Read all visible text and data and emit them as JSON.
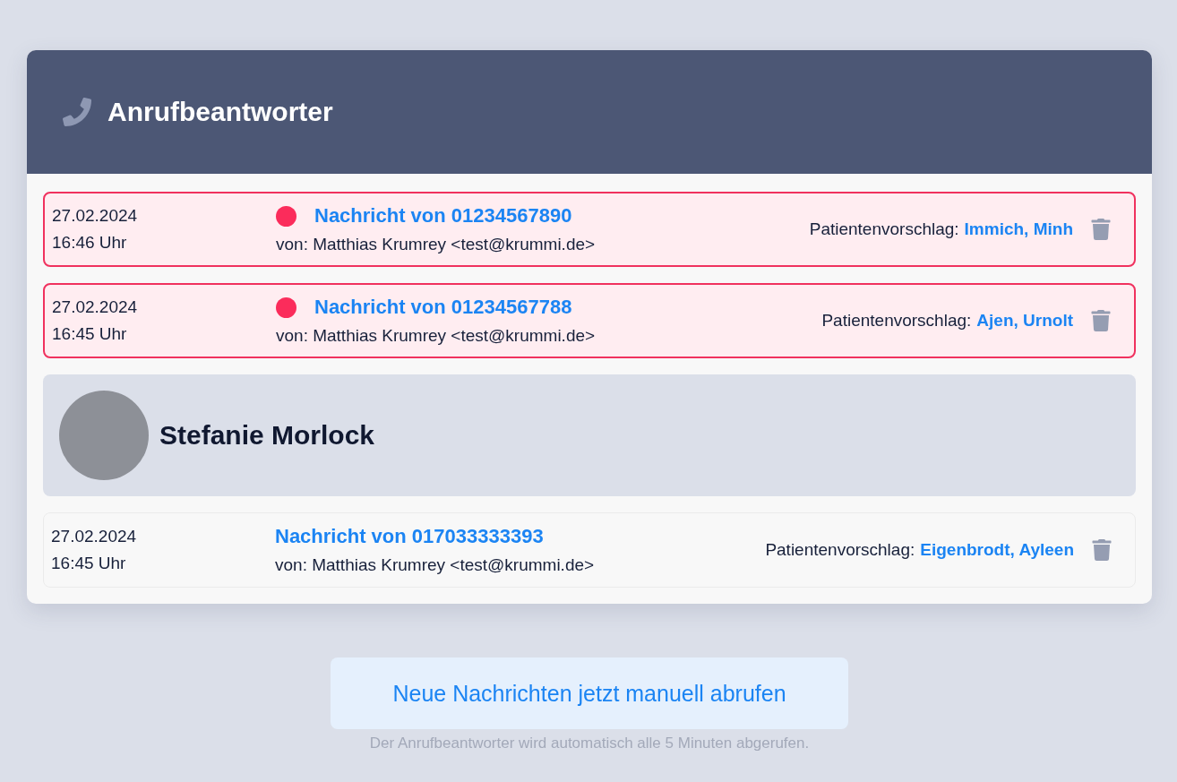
{
  "panel": {
    "title": "Anrufbeantworter"
  },
  "items": [
    {
      "kind": "message",
      "unread": true,
      "date": "27.02.2024",
      "time": "16:46 Uhr",
      "title": "Nachricht von 01234567890",
      "sender": "von: Matthias Krumrey <test@krummi.de>",
      "patient_label": "Patientenvorschlag:",
      "patient_name": "Immich, Minh"
    },
    {
      "kind": "message",
      "unread": true,
      "date": "27.02.2024",
      "time": "16:45 Uhr",
      "title": "Nachricht von 01234567788",
      "sender": "von: Matthias Krumrey <test@krummi.de>",
      "patient_label": "Patientenvorschlag:",
      "patient_name": "Ajen, Urnolt"
    },
    {
      "kind": "group",
      "name": "Stefanie Morlock"
    },
    {
      "kind": "message",
      "unread": false,
      "date": "27.02.2024",
      "time": "16:45 Uhr",
      "title": "Nachricht von 017033333393",
      "sender": "von: Matthias Krumrey <test@krummi.de>",
      "patient_label": "Patientenvorschlag:",
      "patient_name": "Eigenbrodt, Ayleen"
    }
  ],
  "fetch_button": "Neue Nachrichten jetzt manuell abrufen",
  "hint": "Der Anrufbeantworter wird automatisch alle 5 Minuten abgerufen."
}
